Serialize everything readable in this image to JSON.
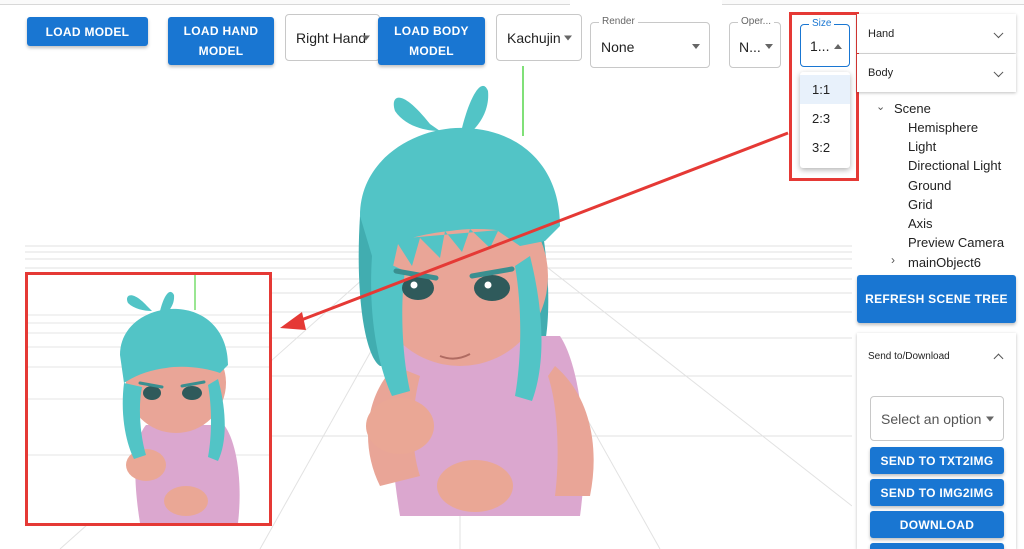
{
  "toolbar": {
    "load_model": "LOAD MODEL",
    "load_hand_model": "LOAD HAND MODEL",
    "hand_select": "Right Hand",
    "load_body_model": "LOAD BODY MODEL",
    "pose_select": "Kachujin",
    "render": {
      "label": "Render",
      "value": "None"
    },
    "operation": {
      "label": "Oper...",
      "value": "N..."
    },
    "size": {
      "label": "Size",
      "value": "1...",
      "options": [
        "1:1",
        "2:3",
        "3:2"
      ],
      "selected": "1:1"
    }
  },
  "sidebar": {
    "hand_label": "Hand",
    "body_label": "Body",
    "scene_tree": {
      "root": "Scene",
      "children": [
        "Hemisphere",
        "Light",
        "Directional Light",
        "Ground",
        "Grid",
        "Axis",
        "Preview Camera"
      ],
      "collapsed_child": "mainObject6"
    },
    "refresh_button": "REFRESH SCENE TREE",
    "send_to_label": "Send to/Download",
    "send_select_placeholder": "Select an option",
    "send_txt2img": "SEND TO TXT2IMG",
    "send_img2img": "SEND TO IMG2IMG",
    "download": "DOWNLOAD"
  },
  "colors": {
    "primary": "#1976d2",
    "highlight": "#e53935",
    "hair": "#52c4c6",
    "skin": "#e9a597",
    "dress": "#dba7cf"
  }
}
